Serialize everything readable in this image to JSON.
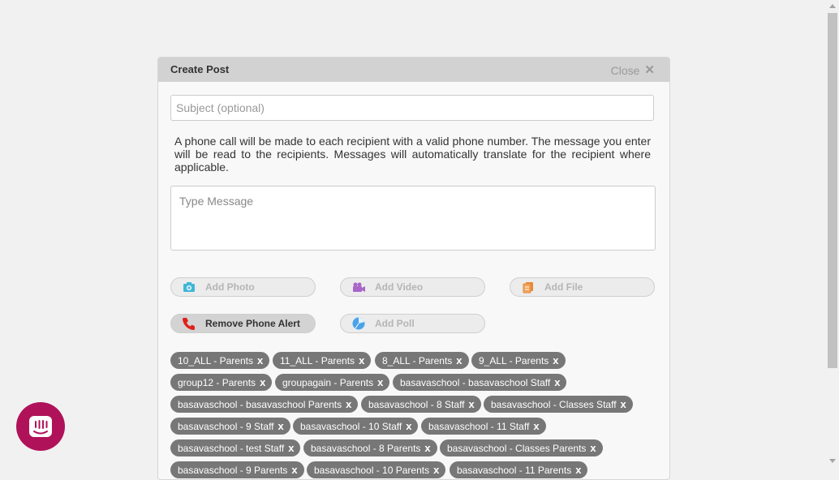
{
  "modal": {
    "title": "Create Post",
    "close_label": "Close",
    "subject_placeholder": "Subject (optional)",
    "notice": "A phone call will be made to each recipient with a valid phone number. The message you enter will be read to the recipients. Messages will automatically translate for the recipient where applicable.",
    "message_placeholder": "Type Message"
  },
  "actions": {
    "add_photo": "Add Photo",
    "add_video": "Add Video",
    "add_file": "Add File",
    "remove_phone_alert": "Remove Phone Alert",
    "add_poll": "Add Poll"
  },
  "recipients": [
    "10_ALL - Parents",
    "11_ALL - Parents",
    "8_ALL - Parents",
    "9_ALL - Parents",
    "group12 - Parents",
    "groupagain - Parents",
    "basavaschool - basavaschool Staff",
    "basavaschool - basavaschool Parents",
    "basavaschool - 8 Staff",
    "basavaschool - Classes Staff",
    "basavaschool - 9 Staff",
    "basavaschool - 10 Staff",
    "basavaschool - 11 Staff",
    "basavaschool - test Staff",
    "basavaschool - 8 Parents",
    "basavaschool - Classes Parents",
    "basavaschool - 9 Parents",
    "basavaschool - 10 Parents",
    "basavaschool - 11 Parents"
  ],
  "tag_remove_glyph": "x",
  "colors": {
    "tag_bg": "#777777",
    "phone_icon": "#e0201a",
    "photo_icon": "#3fb6d6",
    "video_icon": "#a866c8",
    "file_icon": "#e8893a",
    "poll_icon": "#4aa3e8",
    "intercom": "#b0125a"
  }
}
